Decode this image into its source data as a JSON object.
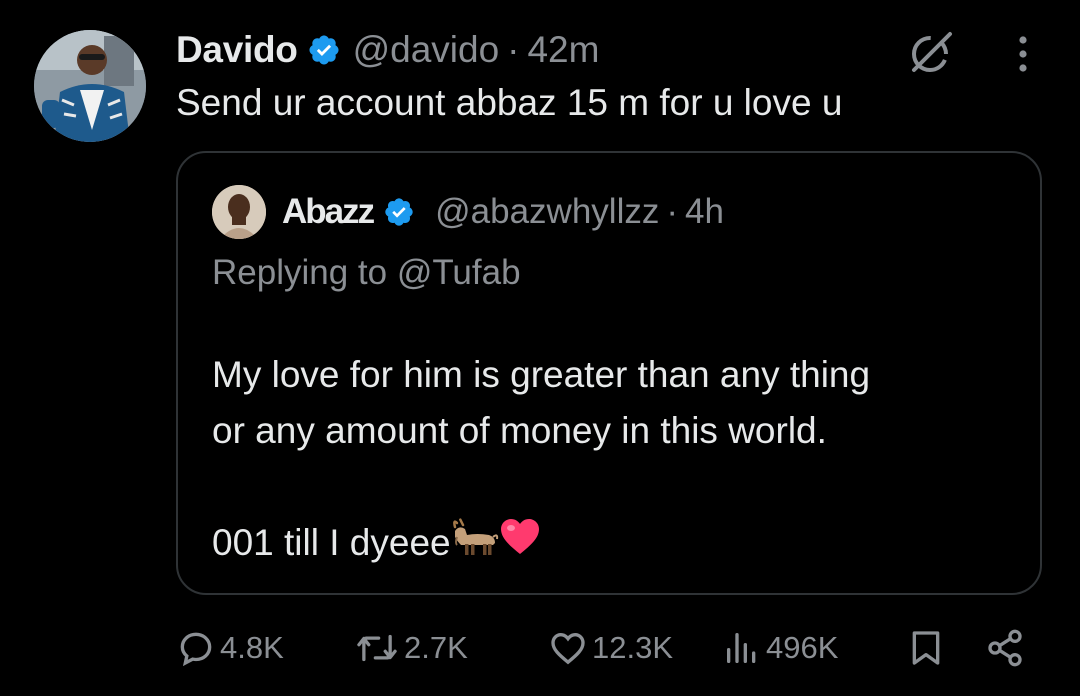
{
  "tweet": {
    "author_name": "Davido",
    "author_handle": "@davido",
    "separator": "·",
    "time": "42m",
    "text": "Send ur account abbaz 15 m for u love u"
  },
  "quoted": {
    "author_name": "Abazz",
    "author_handle": "@abazwhyllzz",
    "separator": "·",
    "time": "4h",
    "replying_to": "Replying to @Tufab",
    "body_lines": [
      "My love for him is greater than any thing",
      "or any amount of money in this world."
    ],
    "sign_off": "001 till I dyeee"
  },
  "actions": {
    "replies": "4.8K",
    "reposts": "2.7K",
    "likes": "12.3K",
    "views": "496K"
  },
  "colors": {
    "background": "#000000",
    "text": "#e7e9ea",
    "muted": "#8b8f94",
    "verified": "#1d9bf0",
    "border": "#2f3336",
    "heart": "#ff3a6e"
  },
  "icons": [
    "verified-badge-icon",
    "grok-icon",
    "more-icon",
    "reply-icon",
    "repost-icon",
    "like-icon",
    "views-icon",
    "bookmark-icon",
    "share-icon",
    "goat-emoji",
    "heart-emoji"
  ]
}
